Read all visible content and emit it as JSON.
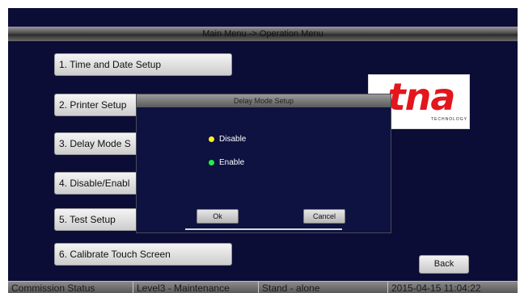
{
  "title_bar": {
    "text": "Main Menu -> Operation Menu"
  },
  "menu": {
    "items": [
      {
        "label": "1. Time and Date Setup"
      },
      {
        "label": "2. Printer Setup"
      },
      {
        "label": "3. Delay Mode S"
      },
      {
        "label": "4. Disable/Enabl"
      },
      {
        "label": "5. Test Setup"
      },
      {
        "label": "6. Calibrate Touch Screen"
      }
    ]
  },
  "logo": {
    "brand": "tna",
    "sub": "TECHNOLOGY"
  },
  "dialog": {
    "title": "Delay Mode Setup",
    "options": [
      {
        "label": "Disable",
        "dot_color": "#ffee22"
      },
      {
        "label": "Enable",
        "dot_color": "#22ee44"
      }
    ],
    "ok_label": "Ok",
    "cancel_label": "Cancel"
  },
  "back_label": "Back",
  "status_bar": {
    "cells": [
      {
        "text": "Commission Status"
      },
      {
        "text": "Level3 - Maintenance"
      },
      {
        "text": "Stand - alone"
      },
      {
        "text": "2015-04-15 11:04:22"
      }
    ]
  }
}
